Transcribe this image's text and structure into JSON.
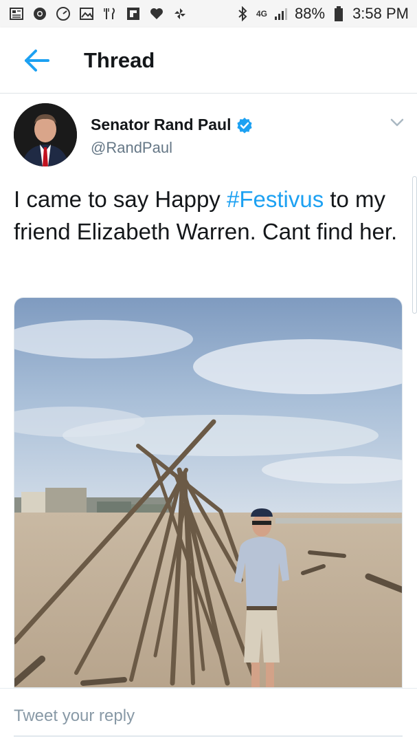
{
  "status_bar": {
    "network": "4G",
    "battery": "88%",
    "time": "3:58 PM",
    "left_icons": [
      "news-icon",
      "chrome-icon",
      "speedometer-icon",
      "gallery-icon",
      "restaurant-icon",
      "flipboard-icon",
      "heart-icon",
      "pinwheel-icon"
    ],
    "right_icons": [
      "bluetooth-icon",
      "network-icon",
      "signal-icon",
      "battery-icon"
    ]
  },
  "header": {
    "title": "Thread",
    "back_icon": "back-arrow-icon",
    "accent": "#1da1f2"
  },
  "tweet": {
    "author_name": "Senator Rand Paul",
    "verified_icon": "verified-badge-icon",
    "handle": "@RandPaul",
    "menu_icon": "chevron-down-icon",
    "text_before": "I came to say Happy ",
    "hashtag": "#Festivus",
    "text_after": " to my friend Elizabeth Warren. Cant find her.",
    "photo_label": "tweet-photo"
  },
  "reply": {
    "placeholder": "Tweet your reply"
  }
}
